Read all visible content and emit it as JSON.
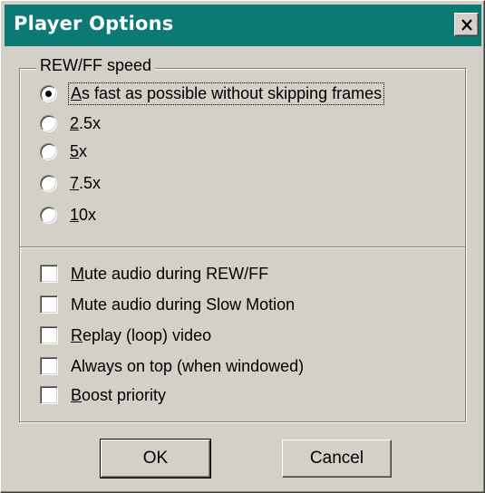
{
  "dialog": {
    "title": "Player Options",
    "close_icon": "close-icon"
  },
  "speed_group": {
    "label": "REW/FF speed",
    "options": [
      {
        "mnemonic": "A",
        "rest": "s fast as possible without skipping frames",
        "selected": true
      },
      {
        "mnemonic": "2",
        "rest": ".5x",
        "selected": false
      },
      {
        "mnemonic": "5",
        "rest": "x",
        "selected": false
      },
      {
        "mnemonic": "7",
        "rest": ".5x",
        "selected": false
      },
      {
        "mnemonic": "1",
        "rest": "0x",
        "selected": false
      }
    ]
  },
  "checkboxes": [
    {
      "mnemonic": "M",
      "rest": "ute audio during REW/FF",
      "checked": false
    },
    {
      "mnemonic": "",
      "rest": "Mute audio during Slow Motion",
      "checked": false
    },
    {
      "mnemonic": "R",
      "rest": "eplay (loop) video",
      "checked": false
    },
    {
      "mnemonic": "",
      "rest": "Always on top (when windowed)",
      "checked": false
    },
    {
      "mnemonic": "B",
      "rest": "oost priority",
      "checked": false
    }
  ],
  "buttons": {
    "ok": "OK",
    "cancel": "Cancel"
  }
}
